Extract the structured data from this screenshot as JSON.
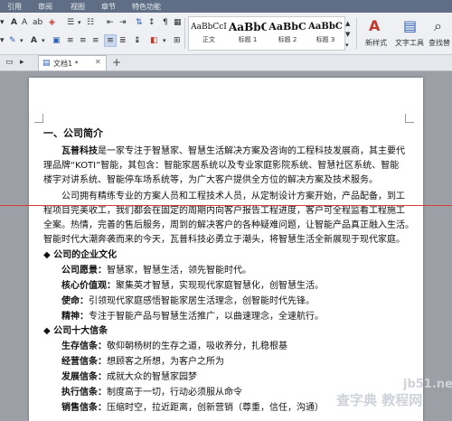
{
  "menu": {
    "items": [
      "引用",
      "审阅",
      "视图",
      "章节",
      "特色功能"
    ]
  },
  "toolbar": {
    "styles": [
      {
        "preview": "AaBbCcI",
        "name": "正文"
      },
      {
        "preview": "AaBbC",
        "name": "标题 1"
      },
      {
        "preview": "AaBbC",
        "name": "标题 2"
      },
      {
        "preview": "AaBbC",
        "name": "标题 3"
      }
    ],
    "new_style_label": "新样式",
    "text_tools_label": "文字工具",
    "find_replace_label": "查找替"
  },
  "tabs": {
    "doc_name": "文档1 *",
    "new_tab": "+"
  },
  "document": {
    "heading": "一、公司简介",
    "p1_lead": "瓦普科技",
    "p1_lines": [
      "是一家专注于智慧家、智慧生活解决方案及咨询的工程科技发展商，其主要代",
      "理品牌“KOTI”智能，其包含：智能家居系统以及专业家庭影院系统、智慧社区系统、智能",
      "楼宇对讲系统、智能停车场系统等，为广大客户提供全方位的解决方案及技术服务。"
    ],
    "p2_lines": [
      "公司拥有精练专业的方案人员和工程技术人员，从定制设计方案开始，产品配备，到工",
      "程项目完美收工，我们都会在固定的周期内向客户报告工程进度，客户可全程监看工程施工",
      "全案。热情，完善的售后服务，周到的解决客户的各种疑难问题，让智能产品真正融入生活。",
      "智能时代大潮奔袭而来的今天，瓦普科技必勇立于潮头，将智慧生活全新展现于现代家庭。"
    ],
    "s1_title": "◆ 公司的企业文化",
    "culture": [
      {
        "label": "公司愿景：",
        "text": "智慧家，智慧生活，领先智能时代。"
      },
      {
        "label": "核心价值观：",
        "text": "聚集英才智慧，实现现代家庭智慧化，创智慧生活。"
      },
      {
        "label": "使命：",
        "text": "引领现代家庭感悟智能家居生活理念，创智能时代先锋。"
      },
      {
        "label": "精神：",
        "text": "专注于智能产品与智慧生活推广，以曲速理念，全速航行。"
      }
    ],
    "s2_title": "◆ 公司十大信条",
    "creeds": [
      {
        "label": "生存信条：",
        "text": "敬仰朝杨树的生存之道，吸收养分，扎稳根基"
      },
      {
        "label": "经营信条：",
        "text": "想顾客之所想，为客户之所为"
      },
      {
        "label": "发展信条：",
        "text": "成就大众的智慧家园梦"
      },
      {
        "label": "执行信条：",
        "text": "制度高于一切，行动必须服从命令"
      },
      {
        "label": "销售信条：",
        "text": "压缩时空，拉近距离，创新营销（尊重，信任，沟通）"
      }
    ]
  },
  "watermark": {
    "line1": "jb51.net",
    "line2": "查字典 教程网"
  },
  "colors": {
    "menubar": "#5f6e84",
    "ribbon": "#eef0f3",
    "red_line": "#d63c3c",
    "accent_blue": "#2c5fb0"
  }
}
